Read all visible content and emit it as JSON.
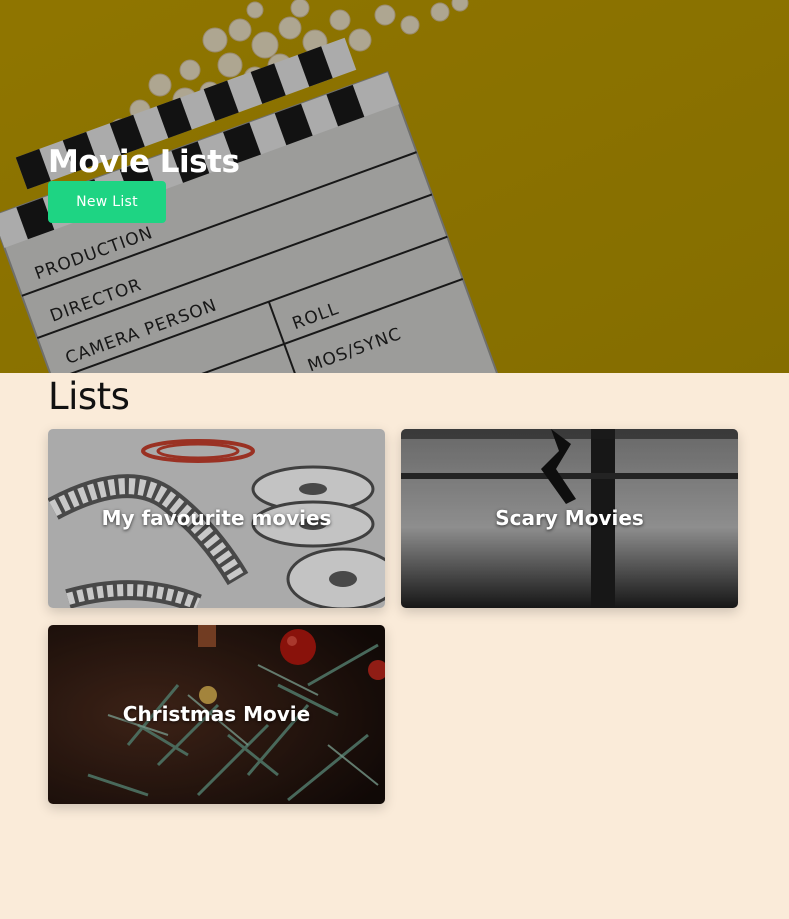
{
  "header": {
    "title": "Movie Lists",
    "new_list_label": "New List",
    "accent_color": "#1ed483",
    "background": "clapperboard-and-popcorn-photo"
  },
  "main": {
    "heading": "Lists",
    "background_color": "#faebd9",
    "lists": [
      {
        "title": "My favourite movies",
        "image": "film-reels-photo"
      },
      {
        "title": "Scary Movies",
        "image": "shadow-silhouette-photo"
      },
      {
        "title": "Christmas Movie",
        "image": "christmas-tree-photo"
      }
    ]
  }
}
